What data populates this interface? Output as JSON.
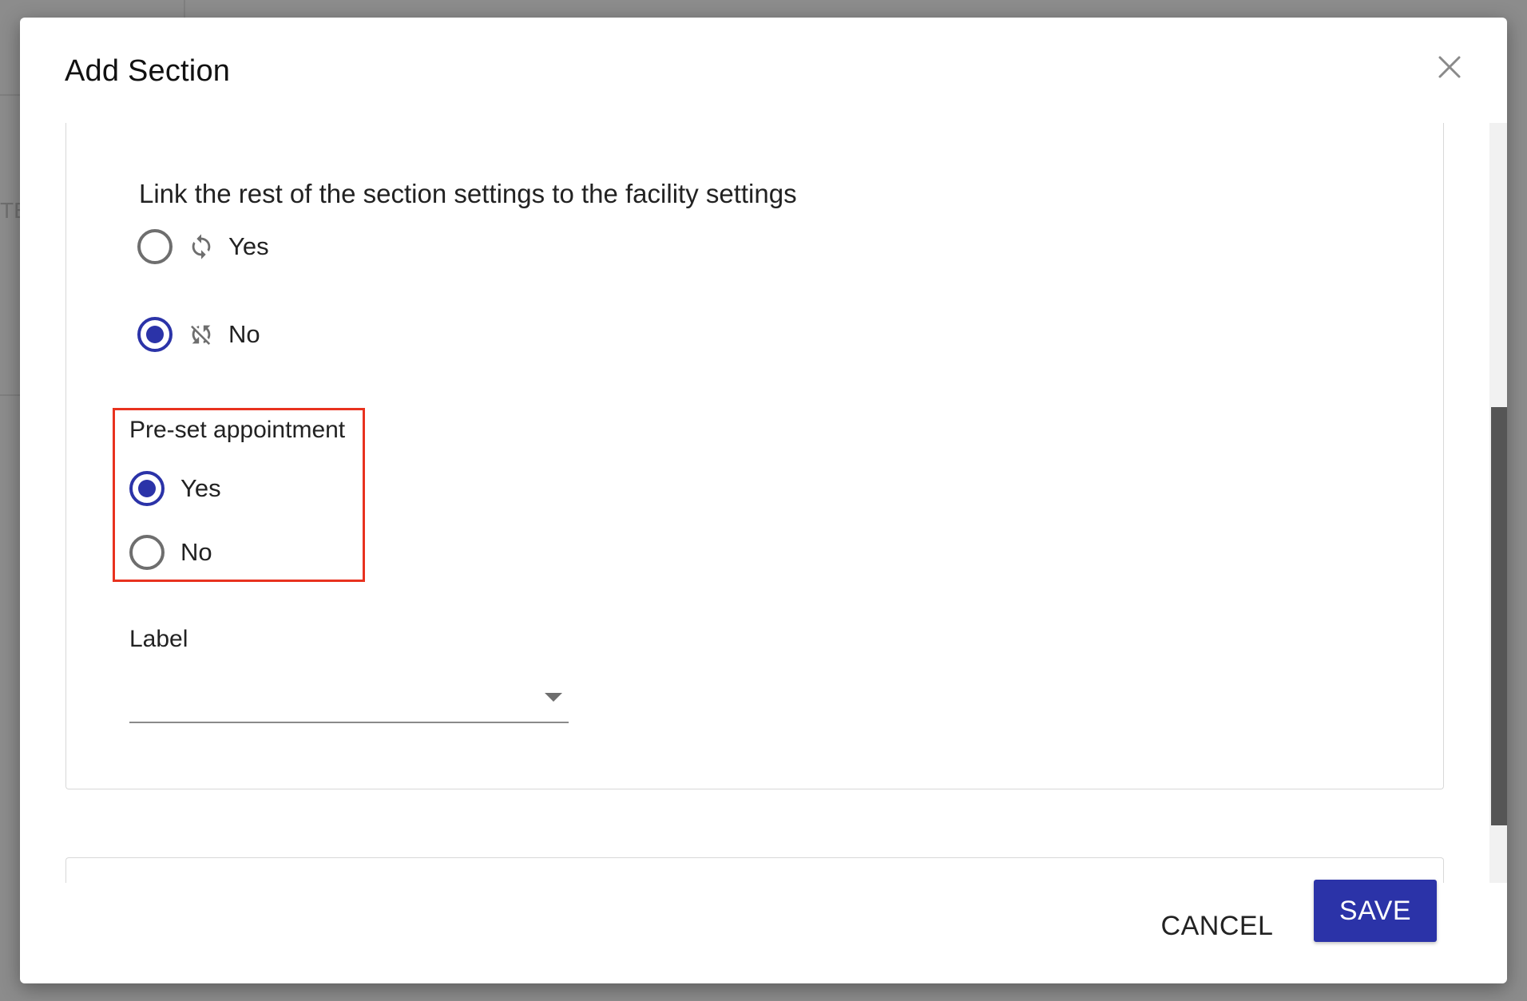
{
  "background": {
    "partial_text": "TE"
  },
  "dialog": {
    "title": "Add Section",
    "close_icon": "close-icon"
  },
  "link_settings": {
    "question": "Link the rest of the section settings to the facility settings",
    "options": [
      {
        "label": "Yes",
        "icon": "sync-icon",
        "checked": false
      },
      {
        "label": "No",
        "icon": "sync-disabled-icon",
        "checked": true
      }
    ]
  },
  "preset_appointment": {
    "label": "Pre-set appointment",
    "options": [
      {
        "label": "Yes",
        "checked": true
      },
      {
        "label": "No",
        "checked": false
      }
    ]
  },
  "label_field": {
    "label": "Label",
    "value": ""
  },
  "actions": {
    "cancel_label": "CANCEL",
    "save_label": "SAVE"
  },
  "colors": {
    "primary": "#2b33a8",
    "highlight": "#e8321f"
  }
}
